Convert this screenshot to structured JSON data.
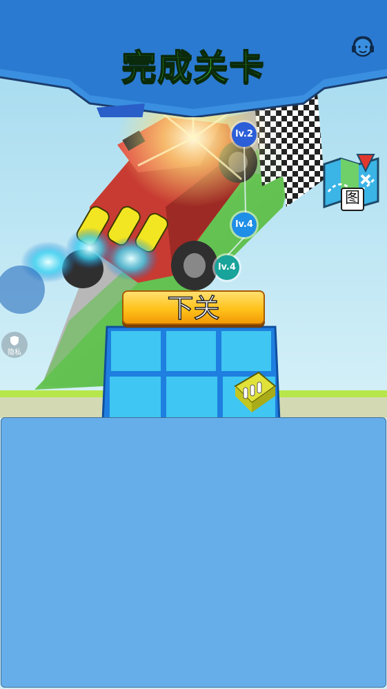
{
  "header": {
    "title": "完成关卡"
  },
  "buttons": {
    "next_level": "下关",
    "map": "图",
    "privacy": "隐私"
  },
  "level_badges": [
    {
      "label": "lv.2"
    },
    {
      "label": "lv.4"
    },
    {
      "label": "lv.4"
    }
  ],
  "icons": {
    "support": "customer-service-headset-icon",
    "map": "map-icon",
    "privacy": "shield-icon"
  },
  "colors": {
    "title_green": "#4ee33a",
    "banner_blue": "#3a8fe0",
    "button_orange": "#ffc21a",
    "panel_blue": "#66aeea"
  }
}
